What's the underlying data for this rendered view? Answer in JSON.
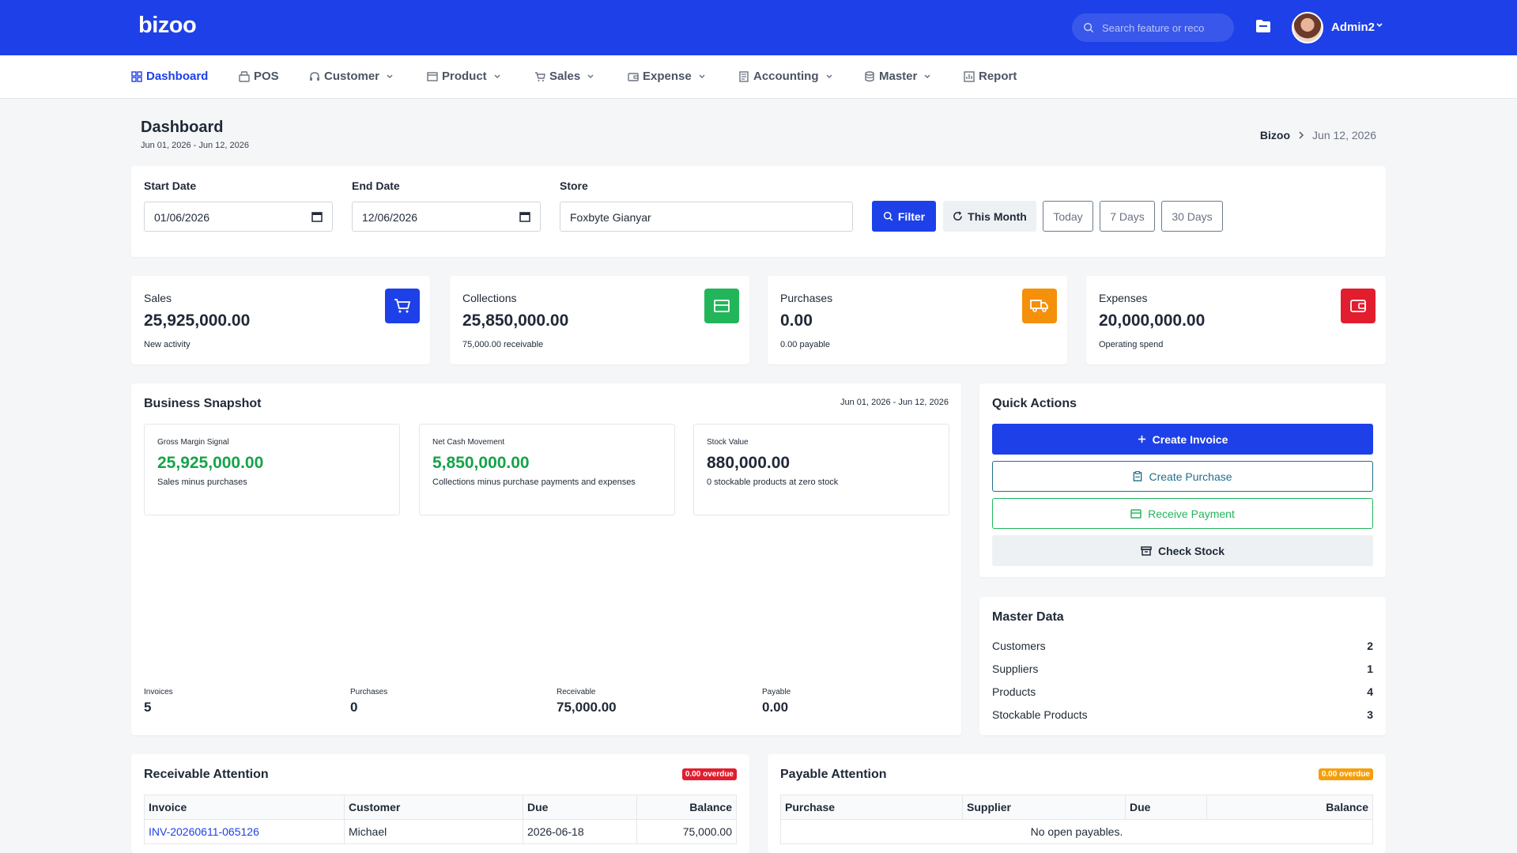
{
  "app": {
    "logo": "bizoo",
    "search_placeholder": "Search feature or reco",
    "user_name": "Admin2"
  },
  "nav": [
    {
      "label": "Dashboard",
      "icon": "grid-icon",
      "active": true
    },
    {
      "label": "POS",
      "icon": "register-icon"
    },
    {
      "label": "Customer",
      "icon": "headset-icon",
      "dropdown": true
    },
    {
      "label": "Product",
      "icon": "box-icon",
      "dropdown": true
    },
    {
      "label": "Sales",
      "icon": "cart-icon",
      "dropdown": true
    },
    {
      "label": "Expense",
      "icon": "wallet-icon",
      "dropdown": true
    },
    {
      "label": "Accounting",
      "icon": "ledger-icon",
      "dropdown": true
    },
    {
      "label": "Master",
      "icon": "database-icon",
      "dropdown": true
    },
    {
      "label": "Report",
      "icon": "report-icon"
    }
  ],
  "header": {
    "title": "Dashboard",
    "range": "Jun 01, 2026 - Jun 12, 2026",
    "breadcrumb_root": "Bizoo",
    "breadcrumb_current": "Jun 12, 2026"
  },
  "filter": {
    "start_label": "Start Date",
    "start_value": "01/06/2026",
    "end_label": "End Date",
    "end_value": "12/06/2026",
    "store_label": "Store",
    "store_value": "Foxbyte Gianyar",
    "filter_btn": "Filter",
    "this_month_btn": "This Month",
    "today_btn": "Today",
    "days7_btn": "7 Days",
    "days30_btn": "30 Days"
  },
  "stats": [
    {
      "label": "Sales",
      "value": "25,925,000.00",
      "sub": "New activity",
      "icon": "cart-icon",
      "color": "#1e40e8"
    },
    {
      "label": "Collections",
      "value": "25,850,000.00",
      "sub": "75,000.00 receivable",
      "icon": "cash-icon",
      "color": "#22b55a"
    },
    {
      "label": "Purchases",
      "value": "0.00",
      "sub": "0.00 payable",
      "icon": "truck-icon",
      "color": "#f5900b"
    },
    {
      "label": "Expenses",
      "value": "20,000,000.00",
      "sub": "Operating spend",
      "icon": "wallet-icon",
      "color": "#e11d2e"
    }
  ],
  "snapshot": {
    "title": "Business Snapshot",
    "range": "Jun 01, 2026 - Jun 12, 2026",
    "metrics": [
      {
        "label": "Gross Margin Signal",
        "value": "25,925,000.00",
        "sub": "Sales minus purchases"
      },
      {
        "label": "Net Cash Movement",
        "value": "5,850,000.00",
        "sub": "Collections minus purchase payments and expenses"
      },
      {
        "label": "Stock Value",
        "value": "880,000.00",
        "sub": "0 stockable products at zero stock"
      }
    ],
    "counts": [
      {
        "label": "Invoices",
        "value": "5"
      },
      {
        "label": "Purchases",
        "value": "0"
      },
      {
        "label": "Receivable",
        "value": "75,000.00"
      },
      {
        "label": "Payable",
        "value": "0.00"
      }
    ]
  },
  "quick_actions": {
    "title": "Quick Actions",
    "create_invoice": "Create Invoice",
    "create_purchase": "Create Purchase",
    "receive_payment": "Receive Payment",
    "check_stock": "Check Stock"
  },
  "master_data": {
    "title": "Master Data",
    "rows": [
      {
        "label": "Customers",
        "count": "2"
      },
      {
        "label": "Suppliers",
        "count": "1"
      },
      {
        "label": "Products",
        "count": "4"
      },
      {
        "label": "Stockable Products",
        "count": "3"
      }
    ]
  },
  "receivable": {
    "title": "Receivable Attention",
    "badge": "0.00 overdue",
    "columns": [
      "Invoice",
      "Customer",
      "Due",
      "Balance"
    ],
    "rows": [
      {
        "invoice": "INV-20260611-065126",
        "customer": "Michael",
        "due": "2026-06-18",
        "balance": "75,000.00"
      }
    ]
  },
  "payable": {
    "title": "Payable Attention",
    "badge": "0.00 overdue",
    "columns": [
      "Purchase",
      "Supplier",
      "Due",
      "Balance"
    ],
    "empty": "No open payables."
  }
}
